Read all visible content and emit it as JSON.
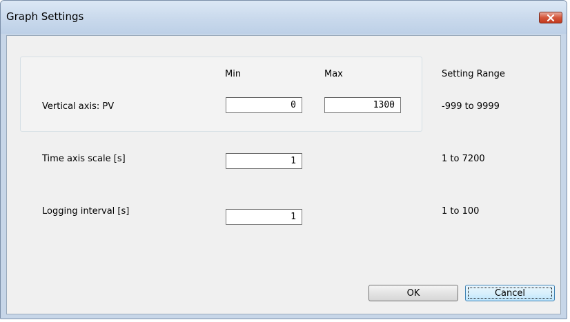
{
  "window": {
    "title": "Graph Settings"
  },
  "headers": {
    "min": "Min",
    "max": "Max",
    "setting_range": "Setting Range"
  },
  "rows": {
    "vertical_axis": {
      "label": "Vertical axis: PV",
      "min_value": "0",
      "max_value": "1300",
      "range": "-999 to 9999"
    },
    "time_axis": {
      "label": "Time axis scale [s]",
      "value": "1",
      "range": "1 to 7200"
    },
    "logging_interval": {
      "label": "Logging interval [s]",
      "value": "1",
      "range": "1 to 100"
    }
  },
  "buttons": {
    "ok": "OK",
    "cancel": "Cancel"
  },
  "icons": {
    "close": "close-icon"
  },
  "colors": {
    "close_button": "#c9452a",
    "title_bar": "#c9d9ec",
    "client_bg": "#f0f0f0"
  }
}
